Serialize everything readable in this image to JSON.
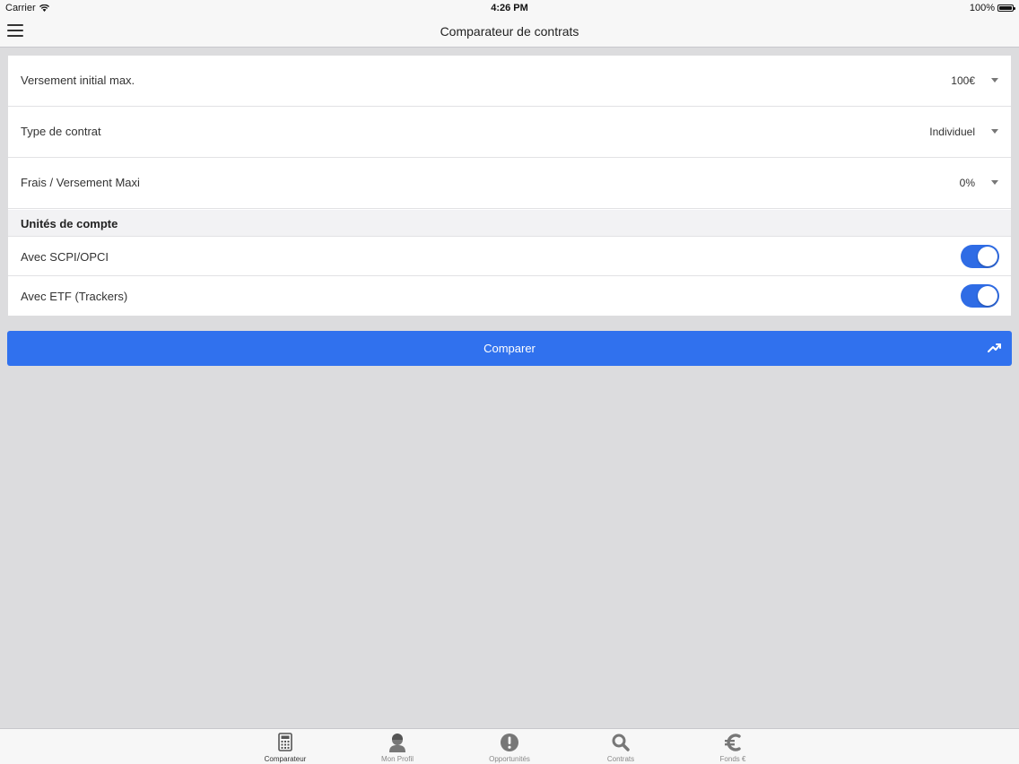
{
  "status_bar": {
    "carrier": "Carrier",
    "time": "4:26 PM",
    "battery": "100%"
  },
  "nav": {
    "title": "Comparateur de contrats",
    "menu_icon": "hamburger-menu-icon"
  },
  "form": {
    "rows": [
      {
        "label": "Versement initial max.",
        "value": "100€"
      },
      {
        "label": "Type de contrat",
        "value": "Individuel"
      },
      {
        "label": "Frais / Versement Maxi",
        "value": "0%"
      }
    ],
    "section_title": "Unités de compte",
    "toggles": [
      {
        "label": "Avec SCPI/OPCI",
        "on": true
      },
      {
        "label": "Avec ETF (Trackers)",
        "on": true
      }
    ]
  },
  "compare_button": {
    "label": "Comparer",
    "icon": "trending-up-icon"
  },
  "tabs": [
    {
      "label": "Comparateur",
      "icon": "calculator-icon",
      "active": true
    },
    {
      "label": "Mon Profil",
      "icon": "user-icon",
      "active": false
    },
    {
      "label": "Opportunités",
      "icon": "exclamation-circle-icon",
      "active": false
    },
    {
      "label": "Contrats",
      "icon": "search-icon",
      "active": false
    },
    {
      "label": "Fonds €",
      "icon": "euro-icon",
      "active": false
    }
  ],
  "colors": {
    "accent": "#3071ee",
    "background": "#dcdcde",
    "toggle_on": "#2f6ce5"
  }
}
